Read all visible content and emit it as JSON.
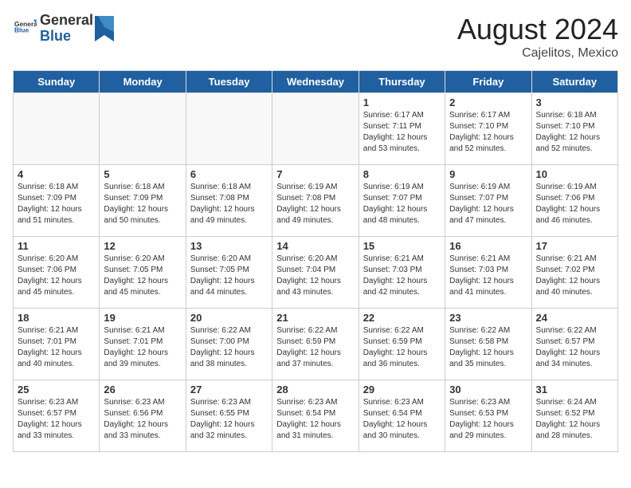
{
  "header": {
    "logo_general": "General",
    "logo_blue": "Blue",
    "month_year": "August 2024",
    "location": "Cajelitos, Mexico"
  },
  "days_of_week": [
    "Sunday",
    "Monday",
    "Tuesday",
    "Wednesday",
    "Thursday",
    "Friday",
    "Saturday"
  ],
  "weeks": [
    [
      {
        "day": "",
        "info": ""
      },
      {
        "day": "",
        "info": ""
      },
      {
        "day": "",
        "info": ""
      },
      {
        "day": "",
        "info": ""
      },
      {
        "day": "1",
        "info": "Sunrise: 6:17 AM\nSunset: 7:11 PM\nDaylight: 12 hours\nand 53 minutes."
      },
      {
        "day": "2",
        "info": "Sunrise: 6:17 AM\nSunset: 7:10 PM\nDaylight: 12 hours\nand 52 minutes."
      },
      {
        "day": "3",
        "info": "Sunrise: 6:18 AM\nSunset: 7:10 PM\nDaylight: 12 hours\nand 52 minutes."
      }
    ],
    [
      {
        "day": "4",
        "info": "Sunrise: 6:18 AM\nSunset: 7:09 PM\nDaylight: 12 hours\nand 51 minutes."
      },
      {
        "day": "5",
        "info": "Sunrise: 6:18 AM\nSunset: 7:09 PM\nDaylight: 12 hours\nand 50 minutes."
      },
      {
        "day": "6",
        "info": "Sunrise: 6:18 AM\nSunset: 7:08 PM\nDaylight: 12 hours\nand 49 minutes."
      },
      {
        "day": "7",
        "info": "Sunrise: 6:19 AM\nSunset: 7:08 PM\nDaylight: 12 hours\nand 49 minutes."
      },
      {
        "day": "8",
        "info": "Sunrise: 6:19 AM\nSunset: 7:07 PM\nDaylight: 12 hours\nand 48 minutes."
      },
      {
        "day": "9",
        "info": "Sunrise: 6:19 AM\nSunset: 7:07 PM\nDaylight: 12 hours\nand 47 minutes."
      },
      {
        "day": "10",
        "info": "Sunrise: 6:19 AM\nSunset: 7:06 PM\nDaylight: 12 hours\nand 46 minutes."
      }
    ],
    [
      {
        "day": "11",
        "info": "Sunrise: 6:20 AM\nSunset: 7:06 PM\nDaylight: 12 hours\nand 45 minutes."
      },
      {
        "day": "12",
        "info": "Sunrise: 6:20 AM\nSunset: 7:05 PM\nDaylight: 12 hours\nand 45 minutes."
      },
      {
        "day": "13",
        "info": "Sunrise: 6:20 AM\nSunset: 7:05 PM\nDaylight: 12 hours\nand 44 minutes."
      },
      {
        "day": "14",
        "info": "Sunrise: 6:20 AM\nSunset: 7:04 PM\nDaylight: 12 hours\nand 43 minutes."
      },
      {
        "day": "15",
        "info": "Sunrise: 6:21 AM\nSunset: 7:03 PM\nDaylight: 12 hours\nand 42 minutes."
      },
      {
        "day": "16",
        "info": "Sunrise: 6:21 AM\nSunset: 7:03 PM\nDaylight: 12 hours\nand 41 minutes."
      },
      {
        "day": "17",
        "info": "Sunrise: 6:21 AM\nSunset: 7:02 PM\nDaylight: 12 hours\nand 40 minutes."
      }
    ],
    [
      {
        "day": "18",
        "info": "Sunrise: 6:21 AM\nSunset: 7:01 PM\nDaylight: 12 hours\nand 40 minutes."
      },
      {
        "day": "19",
        "info": "Sunrise: 6:21 AM\nSunset: 7:01 PM\nDaylight: 12 hours\nand 39 minutes."
      },
      {
        "day": "20",
        "info": "Sunrise: 6:22 AM\nSunset: 7:00 PM\nDaylight: 12 hours\nand 38 minutes."
      },
      {
        "day": "21",
        "info": "Sunrise: 6:22 AM\nSunset: 6:59 PM\nDaylight: 12 hours\nand 37 minutes."
      },
      {
        "day": "22",
        "info": "Sunrise: 6:22 AM\nSunset: 6:59 PM\nDaylight: 12 hours\nand 36 minutes."
      },
      {
        "day": "23",
        "info": "Sunrise: 6:22 AM\nSunset: 6:58 PM\nDaylight: 12 hours\nand 35 minutes."
      },
      {
        "day": "24",
        "info": "Sunrise: 6:22 AM\nSunset: 6:57 PM\nDaylight: 12 hours\nand 34 minutes."
      }
    ],
    [
      {
        "day": "25",
        "info": "Sunrise: 6:23 AM\nSunset: 6:57 PM\nDaylight: 12 hours\nand 33 minutes."
      },
      {
        "day": "26",
        "info": "Sunrise: 6:23 AM\nSunset: 6:56 PM\nDaylight: 12 hours\nand 33 minutes."
      },
      {
        "day": "27",
        "info": "Sunrise: 6:23 AM\nSunset: 6:55 PM\nDaylight: 12 hours\nand 32 minutes."
      },
      {
        "day": "28",
        "info": "Sunrise: 6:23 AM\nSunset: 6:54 PM\nDaylight: 12 hours\nand 31 minutes."
      },
      {
        "day": "29",
        "info": "Sunrise: 6:23 AM\nSunset: 6:54 PM\nDaylight: 12 hours\nand 30 minutes."
      },
      {
        "day": "30",
        "info": "Sunrise: 6:23 AM\nSunset: 6:53 PM\nDaylight: 12 hours\nand 29 minutes."
      },
      {
        "day": "31",
        "info": "Sunrise: 6:24 AM\nSunset: 6:52 PM\nDaylight: 12 hours\nand 28 minutes."
      }
    ]
  ]
}
